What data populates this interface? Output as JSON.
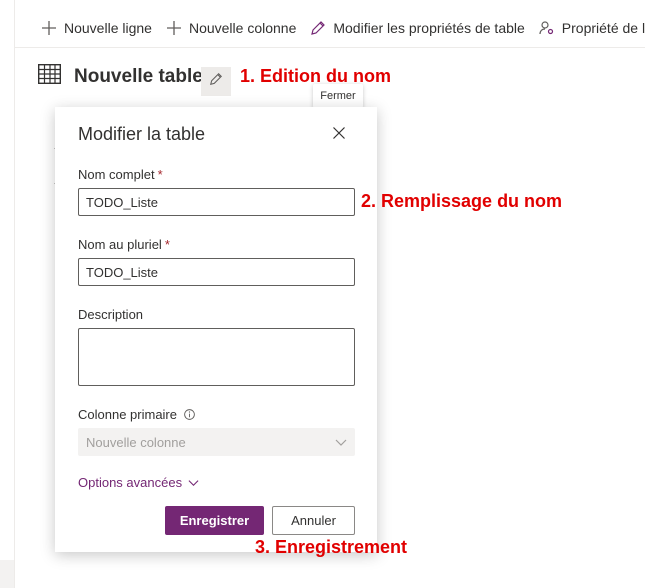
{
  "commandbar": {
    "new_row": "Nouvelle ligne",
    "new_column": "Nouvelle colonne",
    "edit_table_properties": "Modifier les propriétés de table",
    "row_property": "Propriété de ligne"
  },
  "table": {
    "title": "Nouvelle table"
  },
  "tooltip": {
    "close": "Fermer"
  },
  "annotations": {
    "step1": "1. Edition du nom",
    "step2": "2. Remplissage du nom",
    "step3": "3. Enregistrement",
    "color": "#e10000"
  },
  "panel": {
    "title": "Modifier la table",
    "display_name_label": "Nom complet",
    "display_name_value": "TODO_Liste",
    "plural_name_label": "Nom au pluriel",
    "plural_name_value": "TODO_Liste",
    "required_marker": "*",
    "description_label": "Description",
    "description_value": "",
    "primary_column_label": "Colonne primaire",
    "primary_column_value": "Nouvelle colonne",
    "advanced_options": "Options avancées",
    "save": "Enregistrer",
    "cancel": "Annuler",
    "accent_color": "#742774"
  }
}
